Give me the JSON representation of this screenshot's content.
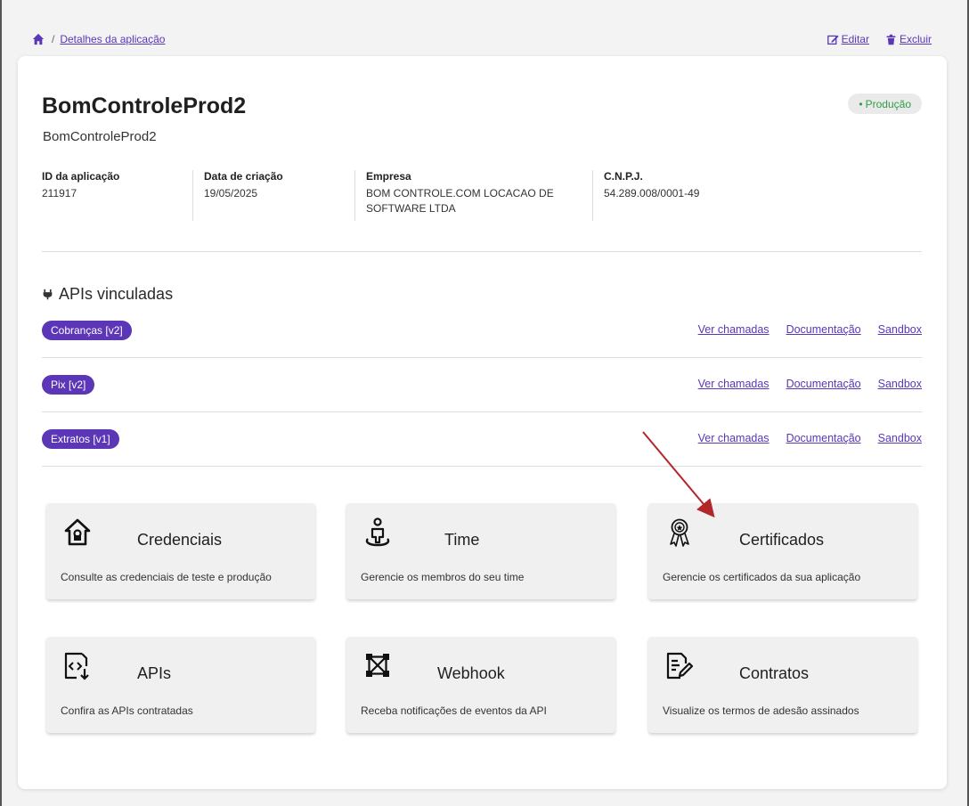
{
  "breadcrumb": {
    "current": "Detalhes da aplicação"
  },
  "actions": {
    "edit": "Editar",
    "delete": "Excluir"
  },
  "app": {
    "title": "BomControleProd2",
    "subtitle": "BomControleProd2",
    "environment": "Produção"
  },
  "info": {
    "id_label": "ID da aplicação",
    "id_value": "211917",
    "date_label": "Data de criação",
    "date_value": "19/05/2025",
    "company_label": "Empresa",
    "company_value_line1": "BOM CONTROLE.COM LOCACAO DE",
    "company_value_line2": "SOFTWARE LTDA",
    "cnpj_label": "C.N.P.J.",
    "cnpj_value": "54.289.008/0001-49"
  },
  "apis": {
    "title": "APIs vinculadas",
    "items": [
      {
        "name": "Cobranças [v2]",
        "calls": "Ver chamadas",
        "docs": "Documentação",
        "sandbox": "Sandbox"
      },
      {
        "name": "Pix [v2]",
        "calls": "Ver chamadas",
        "docs": "Documentação",
        "sandbox": "Sandbox"
      },
      {
        "name": "Extratos [v1]",
        "calls": "Ver chamadas",
        "docs": "Documentação",
        "sandbox": "Sandbox"
      }
    ]
  },
  "tiles": [
    {
      "title": "Credenciais",
      "desc": "Consulte as credenciais de teste e produção",
      "icon": "house-lock-icon"
    },
    {
      "title": "Time",
      "desc": "Gerencie os membros do seu time",
      "icon": "team-icon"
    },
    {
      "title": "Certificados",
      "desc": "Gerencie os certificados da sua aplicação",
      "icon": "certificate-icon"
    },
    {
      "title": "APIs",
      "desc": "Confira as APIs contratadas",
      "icon": "api-file-icon"
    },
    {
      "title": "Webhook",
      "desc": "Receba notificações de eventos da API",
      "icon": "webhook-icon"
    },
    {
      "title": "Contratos",
      "desc": "Visualize os termos de adesão assinados",
      "icon": "contract-icon"
    }
  ],
  "colors": {
    "brand": "#5b36b7",
    "success": "#2f9e44",
    "annotation_arrow": "#b3262a"
  }
}
